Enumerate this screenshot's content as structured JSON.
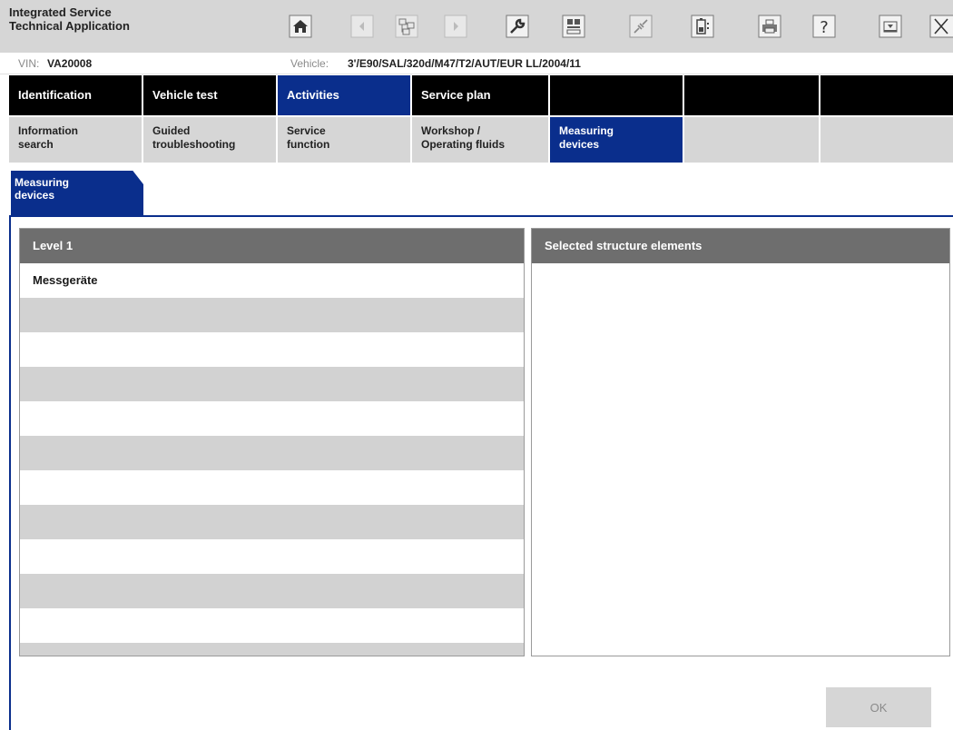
{
  "app": {
    "title": "Integrated Service\nTechnical Application"
  },
  "toolbar": {
    "buttons": [
      {
        "icon": "home-icon"
      },
      {
        "icon": "arrow-left-icon"
      },
      {
        "icon": "structure-icon"
      },
      {
        "icon": "arrow-right-icon"
      },
      {
        "icon": "wrench-icon"
      },
      {
        "icon": "display-icon"
      },
      {
        "icon": "connection-icon"
      },
      {
        "icon": "battery-icon"
      },
      {
        "icon": "printer-icon"
      },
      {
        "icon": "help-icon"
      },
      {
        "icon": "minimize-icon"
      },
      {
        "icon": "close-icon"
      }
    ]
  },
  "vehicle_info": {
    "vin_label": "VIN:",
    "vin_value": "VA20008",
    "vehicle_label": "Vehicle:",
    "vehicle_value": "3'/E90/SAL/320d/M47/T2/AUT/EUR LL/2004/11"
  },
  "main_tabs": [
    {
      "label": "Identification",
      "active": false
    },
    {
      "label": "Vehicle test",
      "active": false
    },
    {
      "label": "Activities",
      "active": true
    },
    {
      "label": "Service plan",
      "active": false
    },
    {
      "label": "",
      "active": false
    },
    {
      "label": "",
      "active": false
    },
    {
      "label": "",
      "active": false
    }
  ],
  "sub_tabs": [
    {
      "label": "Information\nsearch",
      "active": false
    },
    {
      "label": "Guided\ntroubleshooting",
      "active": false
    },
    {
      "label": "Service\nfunction",
      "active": false
    },
    {
      "label": "Workshop /\n Operating fluids",
      "active": false
    },
    {
      "label": "Measuring\ndevices",
      "active": true
    },
    {
      "label": "",
      "active": false
    },
    {
      "label": "",
      "active": false
    }
  ],
  "content_tab": {
    "label": "Measuring\ndevices"
  },
  "left_panel": {
    "header": "Level 1",
    "rows": [
      "Messgeräte",
      "",
      "",
      "",
      "",
      "",
      "",
      "",
      "",
      "",
      "",
      ""
    ]
  },
  "right_panel": {
    "header": "Selected structure elements"
  },
  "ok_button": {
    "label": "OK"
  },
  "colors": {
    "accent_blue": "#0a2e8c",
    "tab_black": "#000000",
    "toolbar_grey": "#d6d6d6",
    "panel_header": "#6e6e6e",
    "stripe": "#d2d2d2"
  }
}
